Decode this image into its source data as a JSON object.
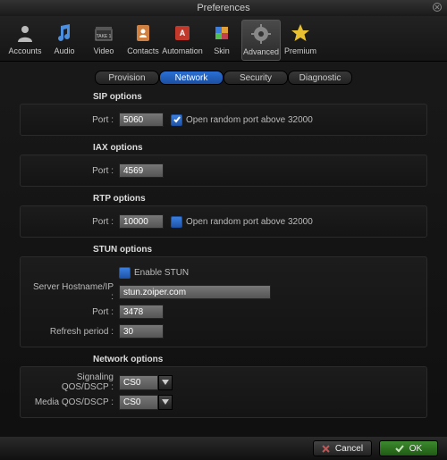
{
  "title": "Preferences",
  "toolbar": [
    {
      "id": "accounts",
      "label": "Accounts"
    },
    {
      "id": "audio",
      "label": "Audio"
    },
    {
      "id": "video",
      "label": "Video"
    },
    {
      "id": "contacts",
      "label": "Contacts"
    },
    {
      "id": "automation",
      "label": "Automation"
    },
    {
      "id": "skin",
      "label": "Skin"
    },
    {
      "id": "advanced",
      "label": "Advanced",
      "selected": true
    },
    {
      "id": "premium",
      "label": "Premium"
    }
  ],
  "tabs": [
    {
      "id": "provision",
      "label": "Provision"
    },
    {
      "id": "network",
      "label": "Network",
      "active": true
    },
    {
      "id": "security",
      "label": "Security"
    },
    {
      "id": "diagnostic",
      "label": "Diagnostic"
    }
  ],
  "sip": {
    "title": "SIP options",
    "port_label": "Port :",
    "port": "5060",
    "random_checked": true,
    "random_label": "Open random port above 32000"
  },
  "iax": {
    "title": "IAX options",
    "port_label": "Port :",
    "port": "4569"
  },
  "rtp": {
    "title": "RTP options",
    "port_label": "Port :",
    "port": "10000",
    "random_checked": false,
    "random_label": "Open random port above 32000"
  },
  "stun": {
    "title": "STUN options",
    "enable_checked": false,
    "enable_label": "Enable STUN",
    "host_label": "Server Hostname/IP :",
    "host": "stun.zoiper.com",
    "port_label": "Port :",
    "port": "3478",
    "refresh_label": "Refresh period :",
    "refresh": "30"
  },
  "network": {
    "title": "Network options",
    "sig_label": "Signaling QOS/DSCP :",
    "sig_value": "CS0",
    "media_label": "Media QOS/DSCP :",
    "media_value": "CS0"
  },
  "footer": {
    "cancel": "Cancel",
    "ok": "OK"
  }
}
